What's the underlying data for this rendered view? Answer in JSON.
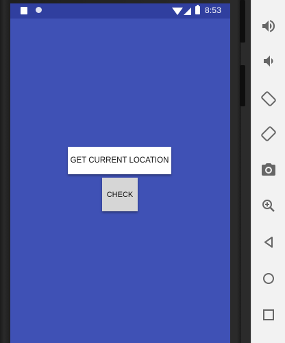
{
  "status_bar": {
    "time": "8:53",
    "icons": [
      "sd-card-icon",
      "circle-notification-icon",
      "wifi-icon",
      "signal-icon",
      "battery-icon"
    ]
  },
  "app": {
    "background_color": "#3f51b5",
    "status_bar_color": "#303f9f",
    "buttons": {
      "get_location_label": "GET CURRENT LOCATION",
      "check_label": "CHECK"
    }
  },
  "emulator_controls": [
    "volume-up-icon",
    "volume-down-icon",
    "rotate-left-icon",
    "rotate-right-icon",
    "camera-icon",
    "zoom-in-icon",
    "back-icon",
    "home-icon",
    "overview-icon"
  ]
}
